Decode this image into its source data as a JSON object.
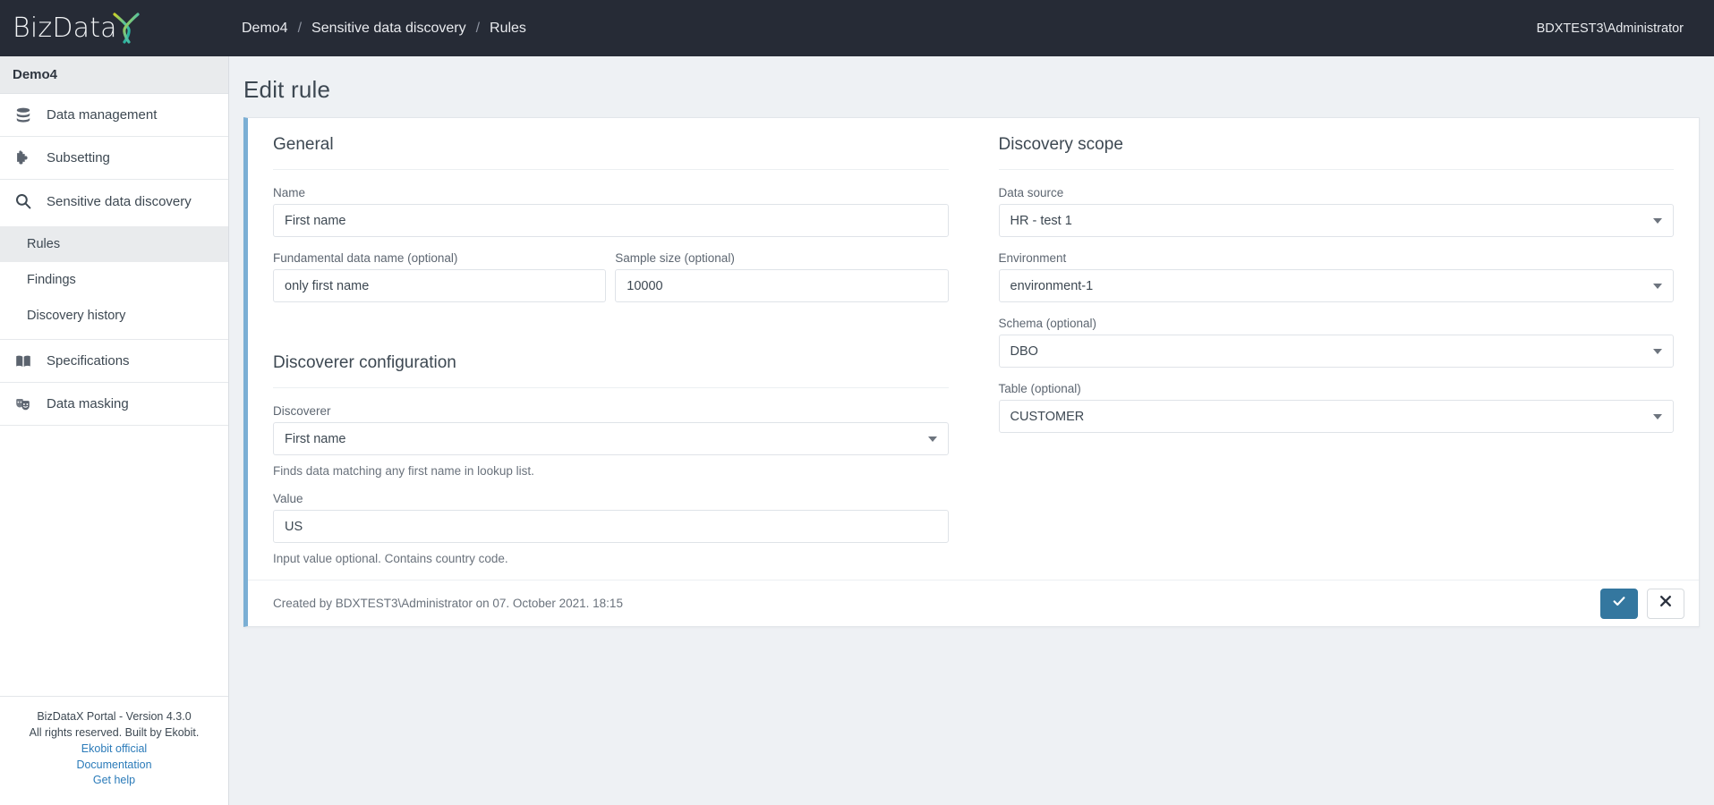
{
  "brand": {
    "logo_text": "BizData",
    "logo_mark": "X",
    "logo_gradient_from": "#c8d22a",
    "logo_gradient_to": "#1aab9b"
  },
  "topbar": {
    "breadcrumb": [
      {
        "label": "Demo4"
      },
      {
        "label": "Sensitive data discovery"
      },
      {
        "label": "Rules"
      }
    ],
    "separator": "/",
    "user": "BDXTEST3\\Administrator",
    "background": "#262b36"
  },
  "sidebar": {
    "project": "Demo4",
    "items": [
      {
        "label": "Data management",
        "icon": "database-icon"
      },
      {
        "label": "Subsetting",
        "icon": "puzzle-piece-icon"
      },
      {
        "label": "Sensitive data discovery",
        "icon": "magnifier-icon",
        "active": true
      },
      {
        "label": "Specifications",
        "icon": "book-icon"
      },
      {
        "label": "Data masking",
        "icon": "theater-masks-icon"
      }
    ],
    "subitems": [
      {
        "label": "Rules",
        "active": true
      },
      {
        "label": "Findings",
        "active": false
      },
      {
        "label": "Discovery history",
        "active": false
      }
    ],
    "footer": {
      "version": "BizDataX Portal - Version 4.3.0",
      "rights": "All rights reserved. Built by Ekobit.",
      "links": [
        {
          "label": "Ekobit official"
        },
        {
          "label": "Documentation"
        },
        {
          "label": "Get help"
        }
      ],
      "link_color": "#2b7bb9"
    }
  },
  "page": {
    "title": "Edit rule",
    "accent_stripe": "#7bafd4",
    "background": "#eef1f4"
  },
  "general": {
    "section_title": "General",
    "name": {
      "label": "Name",
      "value": "First name",
      "placeholder": "Name"
    },
    "fundamental_data_name": {
      "label": "Fundamental data name (optional)",
      "value": "only first name",
      "placeholder": "Fundamental data name"
    },
    "sample_size": {
      "label": "Sample size (optional)",
      "value": "10000",
      "placeholder": "Sample size"
    }
  },
  "discoverer_configuration": {
    "section_title": "Discoverer configuration",
    "discoverer": {
      "label": "Discoverer",
      "value": "First name"
    },
    "discoverer_help": "Finds data matching any first name in lookup list.",
    "value_field": {
      "label": "Value",
      "value": "US",
      "placeholder": "Value"
    },
    "value_help": "Input value optional. Contains country code."
  },
  "discovery_scope": {
    "section_title": "Discovery scope",
    "data_source": {
      "label": "Data source",
      "value": "HR - test 1"
    },
    "environment": {
      "label": "Environment",
      "value": "environment-1"
    },
    "schema": {
      "label": "Schema (optional)",
      "value": "DBO"
    },
    "table": {
      "label": "Table (optional)",
      "value": "CUSTOMER"
    }
  },
  "card_footer": {
    "created_by": "Created by BDXTEST3\\Administrator on 07. October 2021. 18:15",
    "save_icon": "check-icon",
    "cancel_icon": "close-icon",
    "save_color": "#34779f"
  }
}
